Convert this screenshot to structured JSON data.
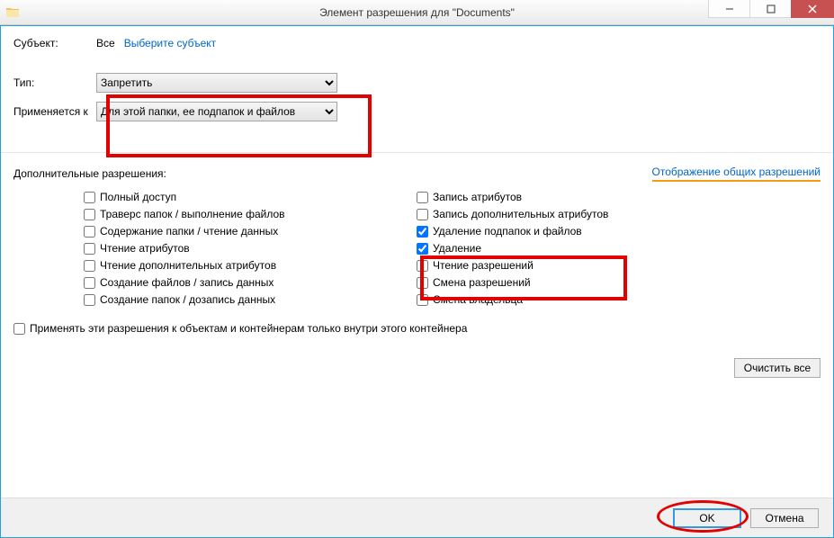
{
  "window": {
    "title": "Элемент разрешения для \"Documents\""
  },
  "labels": {
    "subject": "Субъект:",
    "type": "Тип:",
    "applies_to": "Применяется к",
    "advanced_permissions": "Дополнительные разрешения:",
    "show_basic": "Отображение общих разрешений",
    "only_within": "Применять эти разрешения к объектам и контейнерам только внутри этого контейнера",
    "clear_all": "Очистить все",
    "ok": "OK",
    "cancel": "Отмена"
  },
  "subject": {
    "value": "Все",
    "select_link": "Выберите субъект"
  },
  "type": {
    "selected": "Запретить"
  },
  "applies_to": {
    "selected": "Для этой папки, ее подпапок и файлов"
  },
  "permissions_left": [
    {
      "label": "Полный доступ",
      "checked": false
    },
    {
      "label": "Траверс папок / выполнение файлов",
      "checked": false
    },
    {
      "label": "Содержание папки / чтение данных",
      "checked": false
    },
    {
      "label": "Чтение атрибутов",
      "checked": false
    },
    {
      "label": "Чтение дополнительных атрибутов",
      "checked": false
    },
    {
      "label": "Создание файлов / запись данных",
      "checked": false
    },
    {
      "label": "Создание папок / дозапись данных",
      "checked": false
    }
  ],
  "permissions_right": [
    {
      "label": "Запись атрибутов",
      "checked": false
    },
    {
      "label": "Запись дополнительных атрибутов",
      "checked": false
    },
    {
      "label": "Удаление подпапок и файлов",
      "checked": true
    },
    {
      "label": "Удаление",
      "checked": true
    },
    {
      "label": "Чтение разрешений",
      "checked": false
    },
    {
      "label": "Смена разрешений",
      "checked": false
    },
    {
      "label": "Смена владельца",
      "checked": false
    }
  ],
  "only_within_checked": false
}
